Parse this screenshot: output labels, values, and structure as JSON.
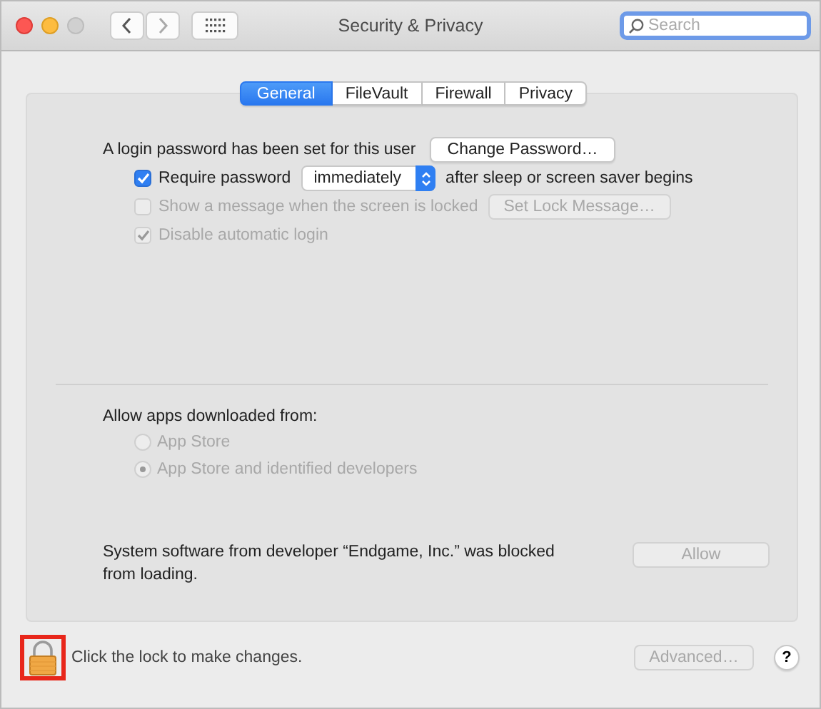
{
  "window": {
    "title": "Security & Privacy"
  },
  "search": {
    "placeholder": "Search"
  },
  "tabs": [
    {
      "label": "General",
      "selected": true
    },
    {
      "label": "FileVault",
      "selected": false
    },
    {
      "label": "Firewall",
      "selected": false
    },
    {
      "label": "Privacy",
      "selected": false
    }
  ],
  "login": {
    "text": "A login password has been set for this user",
    "button": "Change Password…"
  },
  "options": [
    {
      "kind": "select",
      "label": "Require password",
      "checked": true,
      "disabled": false,
      "value": "immediately",
      "suffix": "after sleep or screen saver begins"
    },
    {
      "kind": "button",
      "label": "Show a message when the screen is locked",
      "checked": false,
      "disabled": true,
      "button": "Set Lock Message…"
    },
    {
      "kind": "plain",
      "label": "Disable automatic login",
      "checked": true,
      "disabled": true
    }
  ],
  "downloads": {
    "label": "Allow apps downloaded from:",
    "options": [
      {
        "label": "App Store",
        "selected": false,
        "disabled": true
      },
      {
        "label": "App Store and identified developers",
        "selected": true,
        "disabled": true
      }
    ]
  },
  "blocked": {
    "text": "System software from developer “Endgame, Inc.” was blocked from loading.",
    "button": "Allow",
    "disabled": true
  },
  "footer": {
    "lock_text": "Click the lock to make changes.",
    "locked": true,
    "highlighted": true,
    "advanced": "Advanced…",
    "advanced_disabled": true,
    "help": "?"
  }
}
